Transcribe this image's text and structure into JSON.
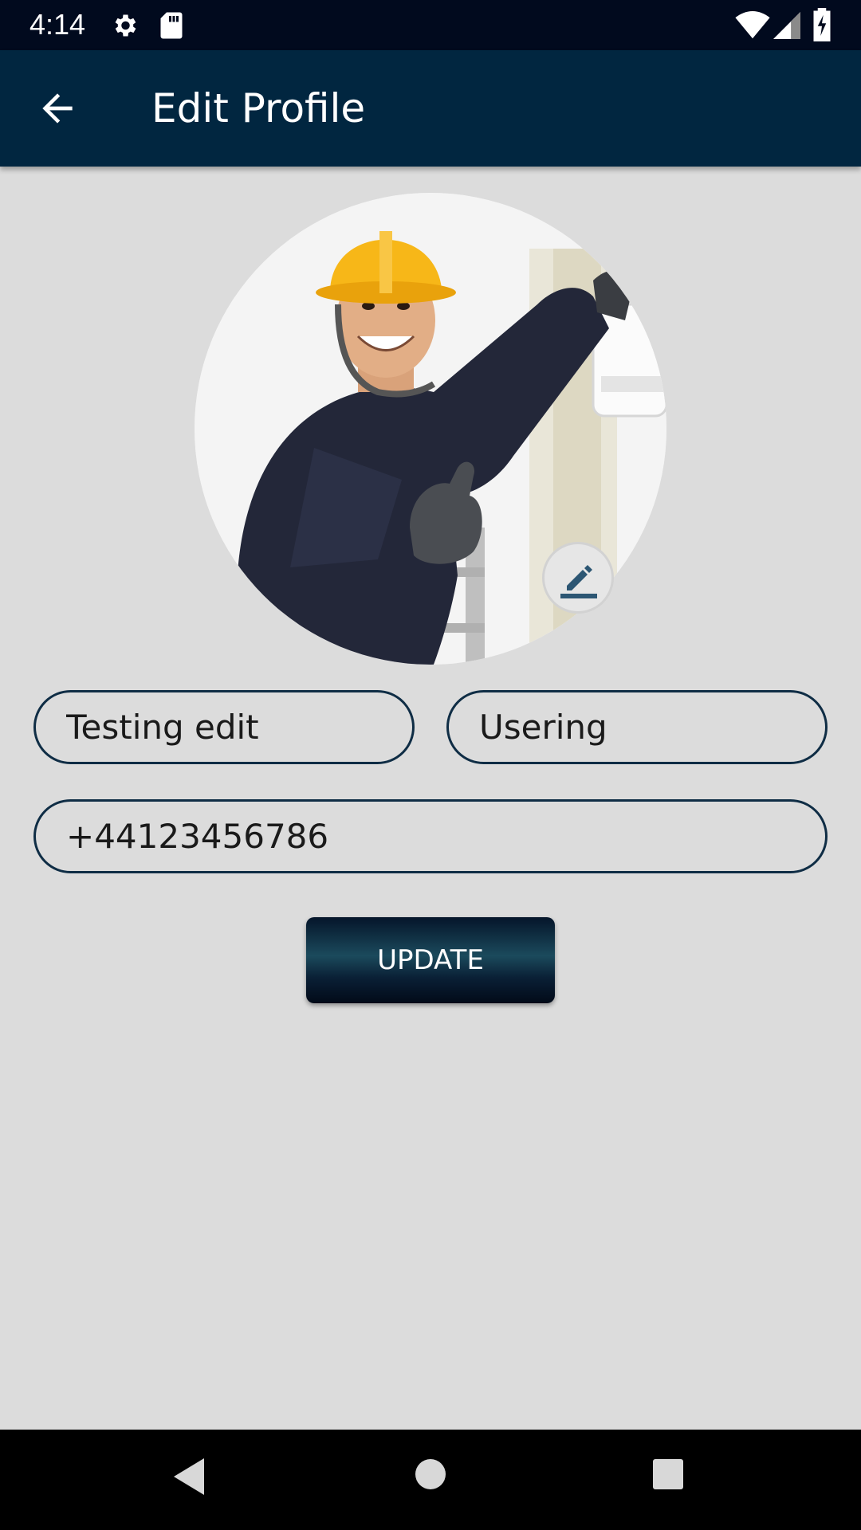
{
  "status_bar": {
    "time": "4:14",
    "icons": [
      "settings-icon",
      "sd-card-icon",
      "wifi-icon",
      "signal-icon",
      "battery-charging-icon"
    ]
  },
  "app_bar": {
    "title": "Edit Profile",
    "back_icon": "arrow-back-icon",
    "background": "#012640"
  },
  "profile": {
    "avatar_description": "profile photo",
    "edit_icon": "pencil-icon"
  },
  "form": {
    "first_name": "Testing edit",
    "last_name": "Usering",
    "phone": "+44123456786",
    "update_label": "UPDATE"
  },
  "nav_bar": {
    "icons": [
      "back-triangle-icon",
      "home-circle-icon",
      "recents-square-icon"
    ]
  },
  "colors": {
    "background": "#dcdcdc",
    "field_border": "#0f2d45",
    "button": "#0a2036"
  }
}
